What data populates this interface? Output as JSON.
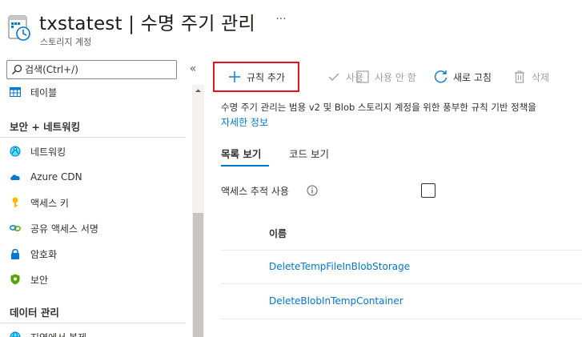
{
  "header": {
    "title": "txstatest | 수명 주기 관리",
    "subtitle": "스토리지 계정",
    "more": "···"
  },
  "sidebar": {
    "search_placeholder": "검색(Ctrl+/)",
    "collapse": "«",
    "items_top": [
      {
        "label": "테이블",
        "icon": "table-icon"
      }
    ],
    "sections": [
      {
        "title": "보안 + 네트워킹",
        "items": [
          {
            "label": "네트워킹",
            "icon": "networking-icon"
          },
          {
            "label": "Azure CDN",
            "icon": "cloud-icon"
          },
          {
            "label": "액세스 키",
            "icon": "key-icon"
          },
          {
            "label": "공유 액세스 서명",
            "icon": "link-icon"
          },
          {
            "label": "암호화",
            "icon": "lock-icon"
          },
          {
            "label": "보안",
            "icon": "shield-icon"
          }
        ]
      },
      {
        "title": "데이터 관리",
        "items": [
          {
            "label": "지역에서 복제",
            "icon": "globe-icon"
          }
        ]
      }
    ]
  },
  "toolbar": {
    "add_rule": "규칙 추가",
    "enable": "사용",
    "disable": "사용 안 함",
    "refresh": "새로 고침",
    "delete": "삭제"
  },
  "content": {
    "description": "수명 주기 관리는 범용 v2 및 Blob 스토리지 계정을 위한 풍부한 규칙 기반 정책을",
    "more_info": "자세한 정보",
    "tabs": [
      "목록 보기",
      "코드 보기"
    ],
    "access_tracking_label": "액세스 추적 사용",
    "access_tracking_checked": false,
    "column_name": "이름",
    "rules": [
      "DeleteTempFileInBlobStorage",
      "DeleteBlobInTempContainer"
    ]
  },
  "colors": {
    "accent": "#0078d4",
    "highlight_border": "#e81123",
    "disabled": "#a19f9d"
  }
}
